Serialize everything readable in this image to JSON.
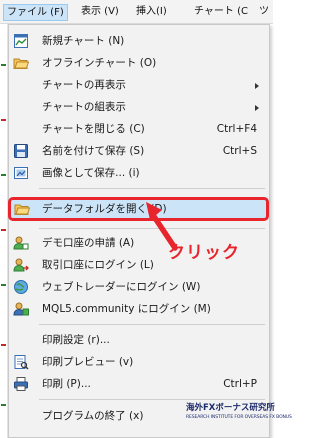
{
  "menubar": {
    "items": [
      {
        "label": "ファイル (F)"
      },
      {
        "label": "表示 (V)"
      },
      {
        "label": "挿入(I)"
      },
      {
        "label": "チャート (C"
      },
      {
        "label": "ツ"
      }
    ]
  },
  "menu": {
    "items": [
      {
        "icon": "new-chart-icon",
        "label": "新規チャート (N)",
        "shortcut": ""
      },
      {
        "icon": "open-folder-icon",
        "label": "オフラインチャート (O)",
        "shortcut": ""
      },
      {
        "icon": "",
        "label": "チャートの再表示",
        "shortcut": "",
        "submenu": true
      },
      {
        "icon": "",
        "label": "チャートの組表示",
        "shortcut": "",
        "submenu": true
      },
      {
        "icon": "",
        "label": "チャートを閉じる (C)",
        "shortcut": "Ctrl+F4"
      },
      {
        "icon": "save-icon",
        "label": "名前を付けて保存 (S)",
        "shortcut": "Ctrl+S"
      },
      {
        "icon": "image-save-icon",
        "label": "画像として保存... (i)",
        "shortcut": ""
      },
      {
        "icon": "folder-icon",
        "label": "データフォルダを開く (D)",
        "shortcut": "",
        "highlighted": true
      },
      {
        "icon": "demo-account-icon",
        "label": "デモ口座の申請 (A)",
        "shortcut": ""
      },
      {
        "icon": "trade-login-icon",
        "label": "取引口座にログイン (L)",
        "shortcut": ""
      },
      {
        "icon": "web-trader-icon",
        "label": "ウェブトレーダーにログイン (W)",
        "shortcut": ""
      },
      {
        "icon": "mql5-icon",
        "label": "MQL5.community にログイン (M)",
        "shortcut": ""
      },
      {
        "icon": "",
        "label": "印刷設定 (r)...",
        "shortcut": ""
      },
      {
        "icon": "print-preview-icon",
        "label": "印刷プレビュー (v)",
        "shortcut": ""
      },
      {
        "icon": "print-icon",
        "label": "印刷 (P)...",
        "shortcut": "Ctrl+P"
      },
      {
        "icon": "",
        "label": "プログラムの終了 (x)",
        "shortcut": ""
      }
    ]
  },
  "annotation": {
    "callout": "クリック"
  },
  "watermark": {
    "title": "海外FXボーナス研究所",
    "subtitle": "RESEARCH INSTITUTE FOR OVERSEAS FX BONUS"
  },
  "colors": {
    "accent": "#e8242c",
    "highlight": "#cce4f7",
    "menu_bg": "#f2f2f2"
  }
}
